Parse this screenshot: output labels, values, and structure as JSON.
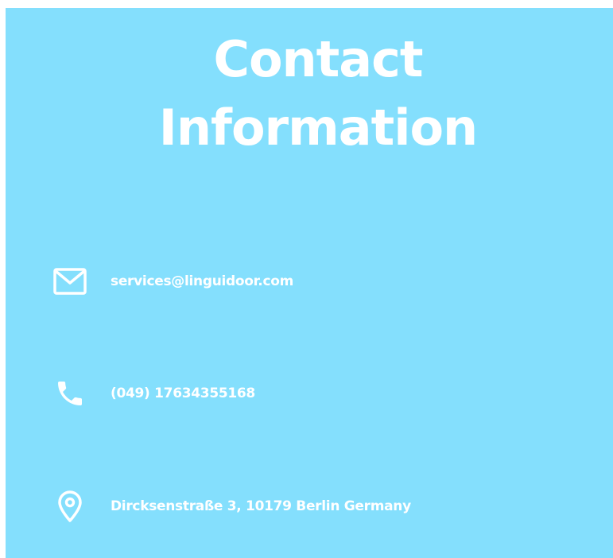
{
  "section": {
    "title_line1": "Contact",
    "title_line2": "Information",
    "background_color": "#84dffd",
    "text_color": "#ffffff"
  },
  "contacts": [
    {
      "icon": "envelope-icon",
      "text": "services@linguidoor.com"
    },
    {
      "icon": "phone-icon",
      "text": "(049) 17634355168"
    },
    {
      "icon": "map-pin-icon",
      "text": "Dircksenstraße 3, 10179 Berlin Germany"
    }
  ]
}
